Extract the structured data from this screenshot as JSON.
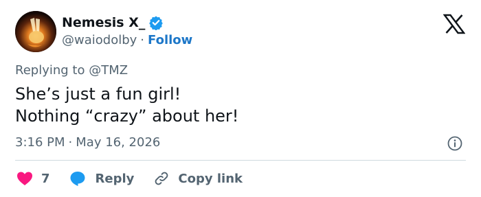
{
  "author": {
    "name": "Nemesis X_",
    "handle": "@waiodolby",
    "separator": "·",
    "follow_label": "Follow",
    "verified": true,
    "avatar_icon": "peace-sign-hand-fire-icon"
  },
  "reply_context": {
    "label": "Replying to @TMZ"
  },
  "tweet": {
    "lines": [
      "She’s just a fun girl!",
      "Nothing “crazy” about her!"
    ]
  },
  "meta": {
    "time": "3:16 PM",
    "separator": "·",
    "date": "May 16, 2026"
  },
  "actions": {
    "likes_count": "7",
    "reply_label": "Reply",
    "copy_label": "Copy link"
  },
  "colors": {
    "like": "#f91880",
    "reply": "#1d9bf0",
    "verified": "#1d9bf0",
    "follow": "#1d77c8",
    "muted": "#536471",
    "divider": "#cfd9de"
  }
}
